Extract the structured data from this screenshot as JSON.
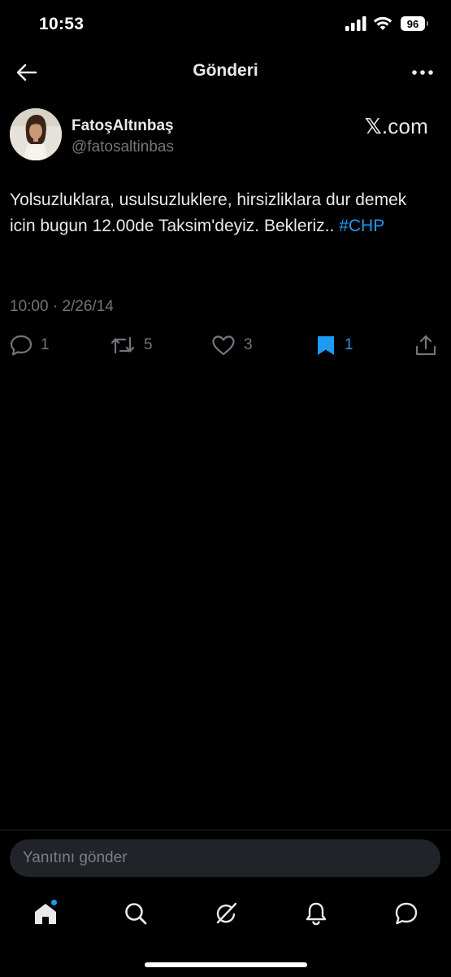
{
  "status_bar": {
    "time": "10:53",
    "battery": "96"
  },
  "top_nav": {
    "title": "Gönderi"
  },
  "post": {
    "author_name": "FatoşAltınbaş",
    "author_handle": "@fatosaltinbas",
    "source_label": ".com",
    "source_glyph": "𝕏",
    "text": "Yolsuzluklara, usulsuzluklere, hirsizliklara dur demek icin bugun 12.00de Taksim'deyiz. Bekleriz.. ",
    "hashtag": "#CHP",
    "time": "10:00",
    "separator": "·",
    "date": "2/26/14"
  },
  "actions": {
    "replies": "1",
    "reposts": "5",
    "likes": "3",
    "bookmarks": "1"
  },
  "reply_bar": {
    "placeholder": "Yanıtını gönder"
  },
  "colors": {
    "background": "#000000",
    "text": "#e7e9ea",
    "secondary": "#71767b",
    "accent": "#1d9bf0"
  },
  "icons": {
    "back": "arrow-left-icon",
    "more": "more-horizontal-icon",
    "reply": "comment-icon",
    "repost": "repost-icon",
    "like": "heart-icon",
    "bookmark": "bookmark-filled-icon",
    "share": "share-icon",
    "home": "home-icon",
    "search": "search-icon",
    "grok": "grok-icon",
    "notifications": "bell-icon",
    "messages": "messages-icon"
  }
}
